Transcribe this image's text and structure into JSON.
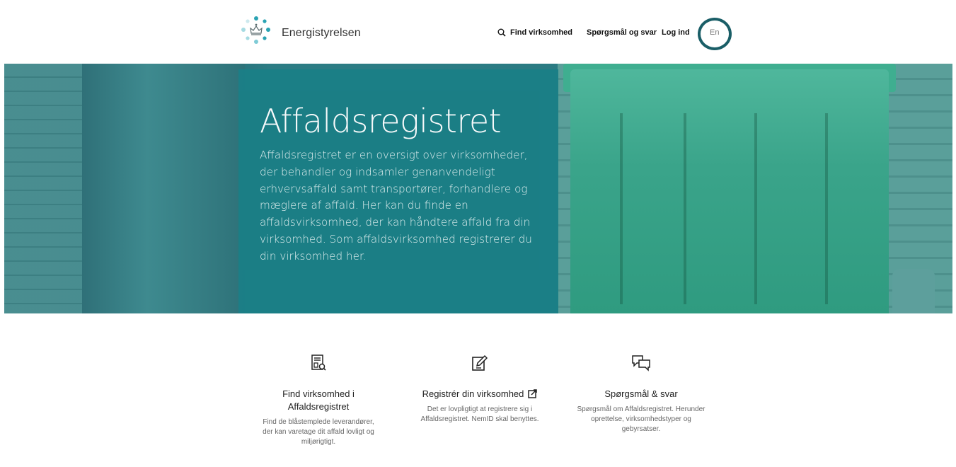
{
  "header": {
    "brand": "Energistyrelsen",
    "nav": {
      "find": "Find virksomhed",
      "faq": "Spørgsmål og svar",
      "login": "Log ind",
      "lang": "En"
    }
  },
  "hero": {
    "title": "Affaldsregistret",
    "text": "Affaldsregistret er en oversigt over virksomheder, der behandler og indsamler genanvendeligt erhvervsaffald samt transportører, forhandlere og mæglere af affald. Her kan du finde en affaldsvirksomhed, der kan håndtere affald fra din virksomhed. Som affaldsvirksomhed registrerer du din virksomhed her."
  },
  "cards": [
    {
      "icon": "search-document-icon",
      "title": "Find virksomhed i Affaldsregistret",
      "desc": "Find de blåstemplede leverandører, der kan varetage dit affald lovligt og miljørigtigt."
    },
    {
      "icon": "edit-document-icon",
      "title": "Registrér din virksomhed",
      "desc": "Det er lovpligtigt at registrere sig i Affaldsregistret. NemID skal benyttes."
    },
    {
      "icon": "chat-bubbles-icon",
      "title": "Spørgsmål & svar",
      "desc": "Spørgsmål om Affaldsregistret. Herunder oprettelse, virksomhedstyper og gebyrsatser."
    }
  ],
  "colors": {
    "accent": "#1b7f86",
    "ring": "#1a5e67"
  }
}
